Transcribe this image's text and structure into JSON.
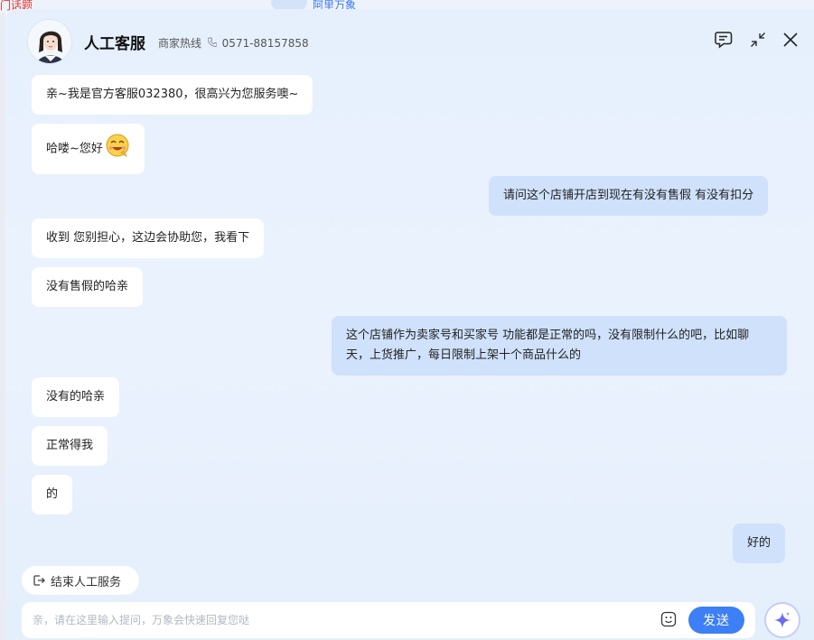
{
  "background": {
    "hot_topic_label": "门话题",
    "brand_label": "阿里万象"
  },
  "header": {
    "title": "人工客服",
    "hotline_label": "商家热线",
    "hotline_number": "0571-88157858",
    "history_icon": "chat-history-icon",
    "minimize_icon": "minimize-icon",
    "close_icon": "close-icon"
  },
  "messages": [
    {
      "from": "bot",
      "text": "亲~我是官方客服032380，很高兴为您服务噢~"
    },
    {
      "from": "bot",
      "text": "哈喽~您好",
      "emoji": "giggle-emoji"
    },
    {
      "from": "user",
      "text": "请问这个店铺开店到现在有没有售假 有没有扣分"
    },
    {
      "from": "bot",
      "text": "收到 您别担心，这边会协助您，我看下"
    },
    {
      "from": "bot",
      "text": "没有售假的哈亲"
    },
    {
      "from": "user",
      "text": "这个店铺作为卖家号和买家号 功能都是正常的吗，没有限制什么的吧，比如聊天，上货推广，每日限制上架十个商品什么的"
    },
    {
      "from": "bot",
      "text": "没有的哈亲"
    },
    {
      "from": "bot",
      "text": "正常得我"
    },
    {
      "from": "bot",
      "text": "的"
    },
    {
      "from": "user",
      "text": "好的"
    }
  ],
  "end_service_label": "结束人工服务",
  "input": {
    "value": "",
    "placeholder": "亲，请在这里输入提问，万象会快速回复您哒"
  },
  "send_label": "发送",
  "colors": {
    "accent": "#3d7ff5",
    "user_bubble": "#cfe1fb",
    "bot_bubble": "#ffffff"
  }
}
